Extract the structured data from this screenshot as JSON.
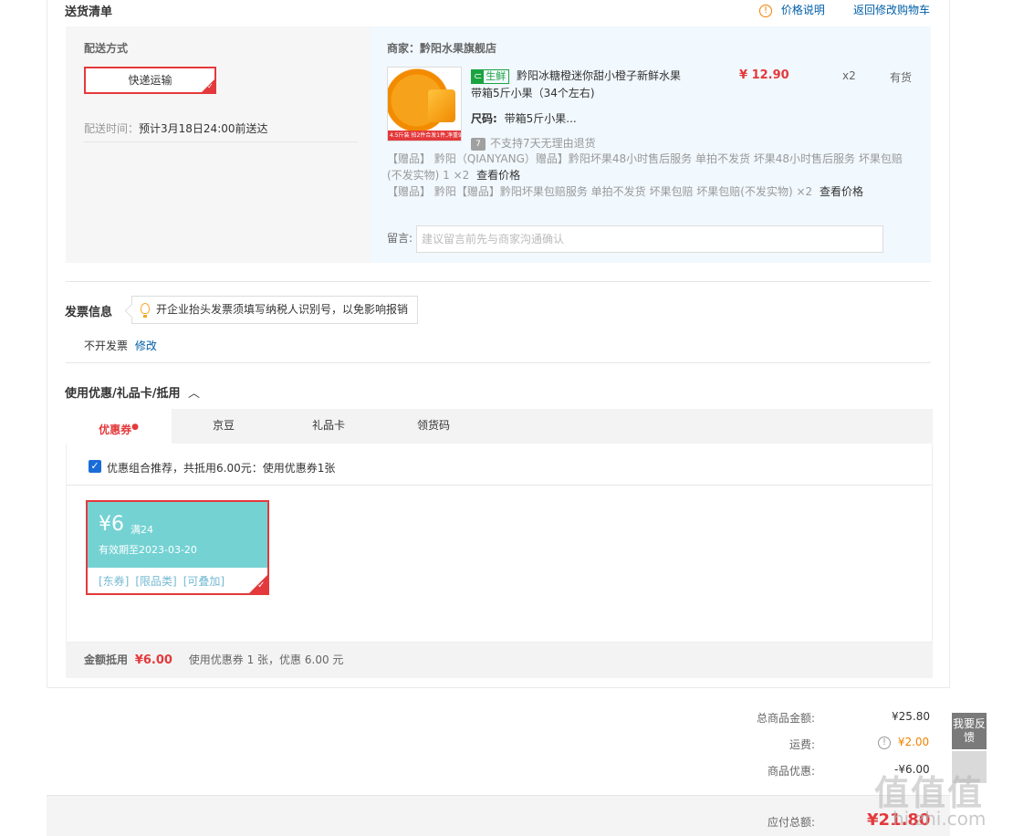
{
  "header": {
    "title": "送货清单",
    "price_note": "价格说明",
    "back_to_cart": "返回修改购物车"
  },
  "shipping": {
    "method_label": "配送方式",
    "method_value": "快递运输",
    "time_label": "配送时间：",
    "time_value": "预计3月18日24:00前送达"
  },
  "shop": {
    "label": "商家：",
    "name": "黔阳水果旗舰店"
  },
  "product": {
    "fresh_tag": "生鲜",
    "title_line1": "黔阳冰糖橙迷你甜小橙子新鲜水果",
    "title_line2": "带箱5斤小果（34个左右)",
    "price": "¥ 12.90",
    "quantity": "x2",
    "stock": "有货",
    "size_label": "尺码:",
    "size_value": "带箱5斤小果...",
    "no_return": "不支持7天无理由退货",
    "image_promo": "4.5斤装 拍2件合发1件,净重9斤",
    "gift1_line1": "【赠品】 黔阳（QIANYANG）赠品】黔阳坏果48小时售后服务 单拍不发货 坏果48小时售后服务 坏果包赔",
    "gift1_line2": "(不发实物) 1 ×2",
    "gift1_see": "查看价格",
    "gift2": "【赠品】 黔阳【赠品】黔阳坏果包赔服务 单拍不发货 坏果包赔 坏果包赔(不发实物) ×2",
    "gift2_see": "查看价格",
    "note_label": "留言:",
    "note_placeholder": "建议留言前先与商家沟通确认"
  },
  "invoice": {
    "title": "发票信息",
    "tip": "开企业抬头发票须填写纳税人识别号，以免影响报销",
    "value": "不开发票",
    "edit": "修改"
  },
  "discount": {
    "title": "使用优惠/礼品卡/抵用",
    "tabs": [
      "优惠券",
      "京豆",
      "礼品卡",
      "领货码"
    ],
    "recommend_text": "优惠组合推荐，共抵用6.00元：使用优惠券1张",
    "coupon": {
      "amount": "¥6",
      "condition": "满24",
      "expiry": "有效期至2023-03-20",
      "tags": [
        "[东券]",
        "[限品类]",
        "[可叠加]"
      ]
    },
    "summary_label": "金额抵用",
    "summary_amount": "¥6.00",
    "summary_desc": "使用优惠券 1 张，优惠 6.00 元"
  },
  "totals": {
    "goods_label": "总商品金额:",
    "goods_value": "¥25.80",
    "freight_label": "运费:",
    "freight_value": "¥2.00",
    "discount_label": "商品优惠:",
    "discount_value": "-¥6.00",
    "payable_label": "应付总额:",
    "payable_value": "¥21.80"
  },
  "side": {
    "feedback": "我要反馈"
  },
  "watermark": {
    "main": "值值值",
    "sub": "hi.zhi.com"
  },
  "colors": {
    "accent_red": "#e4393c",
    "link_blue": "#005ea7",
    "coupon_teal": "#74d2d3",
    "fresh_green": "#1aa43f"
  }
}
